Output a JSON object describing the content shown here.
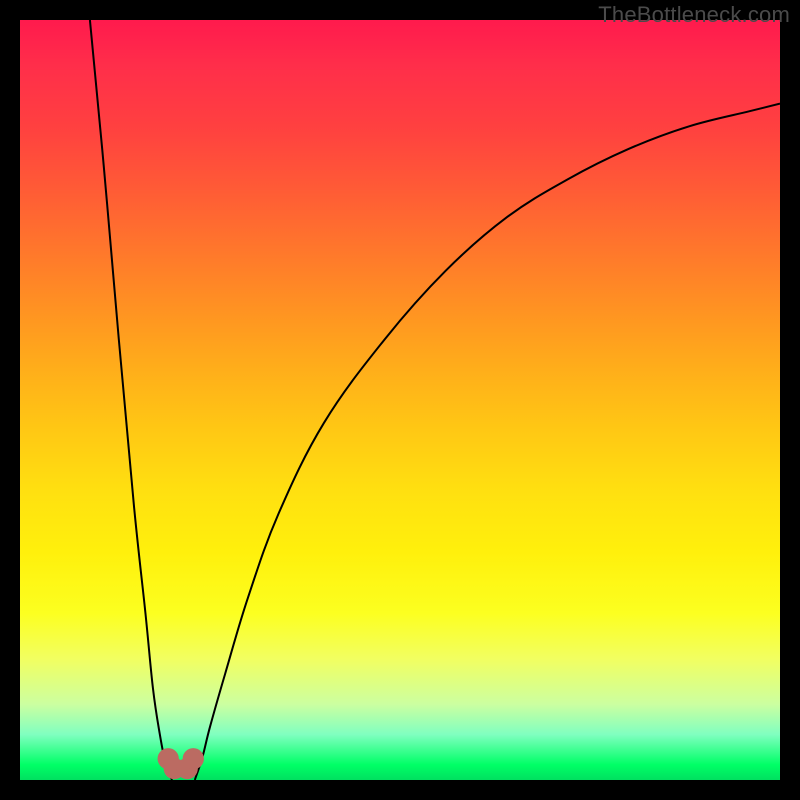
{
  "attribution": "TheBottleneck.com",
  "chart_data": {
    "type": "line",
    "title": "",
    "xlabel": "",
    "ylabel": "",
    "xlim": [
      0,
      100
    ],
    "ylim": [
      0,
      100
    ],
    "background_gradient": {
      "orientation": "vertical",
      "stops": [
        {
          "pos": 0.0,
          "color": "#ff1a4d"
        },
        {
          "pos": 0.5,
          "color": "#ffc814"
        },
        {
          "pos": 0.8,
          "color": "#fcff20"
        },
        {
          "pos": 1.0,
          "color": "#00e060"
        }
      ]
    },
    "series": [
      {
        "name": "left-branch",
        "x": [
          9.2,
          11,
          13,
          15,
          16.5,
          17.5,
          18.4,
          19.2,
          20.0
        ],
        "y": [
          100,
          81,
          58,
          36,
          22,
          12,
          6,
          2,
          0
        ]
      },
      {
        "name": "right-branch",
        "x": [
          23.0,
          24.0,
          25.0,
          27.0,
          30.0,
          34.0,
          40.0,
          48.0,
          56.0,
          64.0,
          72.0,
          80.0,
          88.0,
          96.0,
          100.0
        ],
        "y": [
          0,
          3,
          7,
          14,
          24,
          35,
          47,
          58,
          67,
          74,
          79,
          83,
          86,
          88,
          89
        ]
      }
    ],
    "markers": [
      {
        "name": "trough-left",
        "x": 19.5,
        "y": 2.8,
        "r": 1.4,
        "color": "#bb6b62"
      },
      {
        "name": "trough-mid-l",
        "x": 20.3,
        "y": 1.5,
        "r": 1.4,
        "color": "#bb6b62"
      },
      {
        "name": "trough-mid-r",
        "x": 22.0,
        "y": 1.5,
        "r": 1.4,
        "color": "#bb6b62"
      },
      {
        "name": "trough-right",
        "x": 22.8,
        "y": 2.8,
        "r": 1.4,
        "color": "#bb6b62"
      }
    ],
    "curve_stroke": {
      "color": "#000000",
      "width": 2
    }
  }
}
